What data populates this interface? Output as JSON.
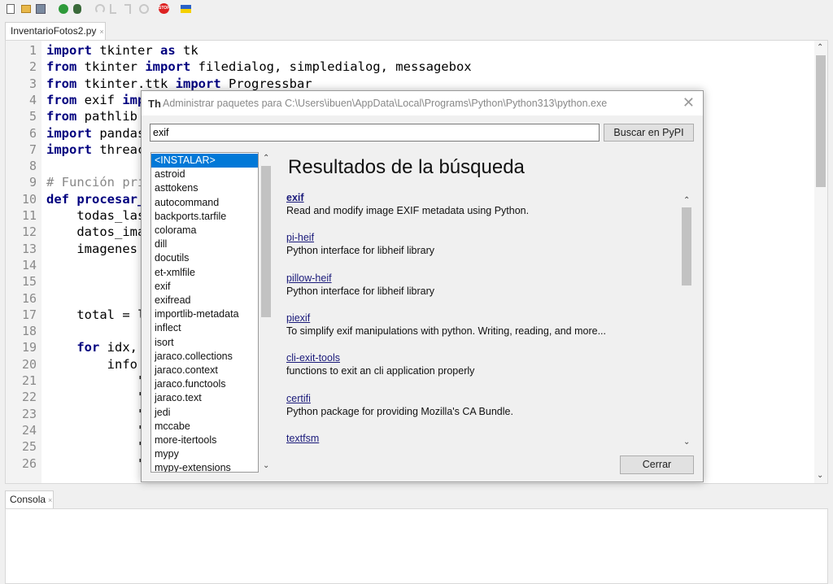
{
  "toolbar": {
    "icons": [
      "new-file-icon",
      "open-file-icon",
      "save-icon",
      "run-icon",
      "debug-icon",
      "step-over-icon",
      "step-into-icon",
      "step-out-icon",
      "resume-icon",
      "stop-icon",
      "ukraine-flag-icon"
    ],
    "stop_label": "STOP"
  },
  "editor": {
    "tab_label": "InventarioFotos2.py",
    "tab_close": "×",
    "lines": [
      {
        "n": "1",
        "segs": [
          {
            "t": "import",
            "k": "kw"
          },
          {
            "t": " tkinter "
          },
          {
            "t": "as",
            "k": "kw"
          },
          {
            "t": " tk"
          }
        ]
      },
      {
        "n": "2",
        "segs": [
          {
            "t": "from",
            "k": "kw"
          },
          {
            "t": " tkinter "
          },
          {
            "t": "import",
            "k": "kw"
          },
          {
            "t": " filedialog, simpledialog, messagebox"
          }
        ]
      },
      {
        "n": "3",
        "segs": [
          {
            "t": "from",
            "k": "kw"
          },
          {
            "t": " tkinter.ttk "
          },
          {
            "t": "import",
            "k": "kw"
          },
          {
            "t": " Progressbar"
          }
        ]
      },
      {
        "n": "4",
        "segs": [
          {
            "t": "from",
            "k": "kw"
          },
          {
            "t": " exif "
          },
          {
            "t": "imp",
            "k": "kw"
          }
        ]
      },
      {
        "n": "5",
        "segs": [
          {
            "t": "from",
            "k": "kw"
          },
          {
            "t": " pathlib"
          }
        ]
      },
      {
        "n": "6",
        "segs": [
          {
            "t": "import",
            "k": "kw"
          },
          {
            "t": " pandas"
          }
        ]
      },
      {
        "n": "7",
        "segs": [
          {
            "t": "import",
            "k": "kw"
          },
          {
            "t": " threac"
          }
        ]
      },
      {
        "n": "8",
        "segs": []
      },
      {
        "n": "9",
        "segs": [
          {
            "t": "# Función pri",
            "k": "cm"
          }
        ]
      },
      {
        "n": "10",
        "segs": [
          {
            "t": "def",
            "k": "kw"
          },
          {
            "t": " "
          },
          {
            "t": "procesar_",
            "k": "kw"
          }
        ]
      },
      {
        "n": "11",
        "segs": [
          {
            "t": "    todas_las"
          }
        ]
      },
      {
        "n": "12",
        "segs": [
          {
            "t": "    datos_ima"
          }
        ]
      },
      {
        "n": "13",
        "segs": [
          {
            "t": "    imagenes "
          }
        ]
      },
      {
        "n": "14",
        "segs": []
      },
      {
        "n": "15",
        "segs": []
      },
      {
        "n": "16",
        "segs": []
      },
      {
        "n": "17",
        "segs": [
          {
            "t": "    total = l"
          }
        ]
      },
      {
        "n": "18",
        "segs": []
      },
      {
        "n": "19",
        "segs": [
          {
            "t": "    "
          },
          {
            "t": "for",
            "k": "kw"
          },
          {
            "t": " idx,"
          }
        ]
      },
      {
        "n": "20",
        "segs": [
          {
            "t": "        info"
          }
        ]
      },
      {
        "n": "21",
        "segs": [
          {
            "t": "            \""
          }
        ]
      },
      {
        "n": "22",
        "segs": [
          {
            "t": "            \""
          }
        ]
      },
      {
        "n": "23",
        "segs": [
          {
            "t": "            \""
          }
        ]
      },
      {
        "n": "24",
        "segs": [
          {
            "t": "            \""
          }
        ]
      },
      {
        "n": "25",
        "segs": [
          {
            "t": "            \""
          }
        ]
      },
      {
        "n": "26",
        "segs": [
          {
            "t": "            \""
          }
        ]
      }
    ]
  },
  "console": {
    "tab_label": "Consola",
    "tab_close": "×"
  },
  "dialog": {
    "title": "Administrar paquetes para C:\\Users\\ibuen\\AppData\\Local\\Programs\\Python\\Python313\\python.exe",
    "icon_glyph": "Th",
    "close_glyph": "✕",
    "search_value": "exif",
    "search_button": "Buscar en PyPI",
    "results_heading": "Resultados de la búsqueda",
    "close_button": "Cerrar",
    "packages": [
      "<INSTALAR>",
      "astroid",
      "asttokens",
      "autocommand",
      "backports.tarfile",
      "colorama",
      "dill",
      "docutils",
      "et-xmlfile",
      "exif",
      "exifread",
      "importlib-metadata",
      "inflect",
      "isort",
      "jaraco.collections",
      "jaraco.context",
      "jaraco.functools",
      "jaraco.text",
      "jedi",
      "mccabe",
      "more-itertools",
      "mypy",
      "mypy-extensions"
    ],
    "selected_package": 0,
    "results": [
      {
        "name": "exif",
        "desc": "Read and modify image EXIF metadata using Python.",
        "bold": true
      },
      {
        "name": "pi-heif",
        "desc": "Python interface for libheif library"
      },
      {
        "name": "pillow-heif",
        "desc": "Python interface for libheif library"
      },
      {
        "name": "piexif",
        "desc": "To simplify exif manipulations with python. Writing, reading, and more..."
      },
      {
        "name": "cli-exit-tools",
        "desc": "functions to exit an cli application properly"
      },
      {
        "name": "certifi",
        "desc": "Python package for providing Mozilla's CA Bundle."
      },
      {
        "name": "textfsm",
        "desc": ""
      }
    ]
  }
}
